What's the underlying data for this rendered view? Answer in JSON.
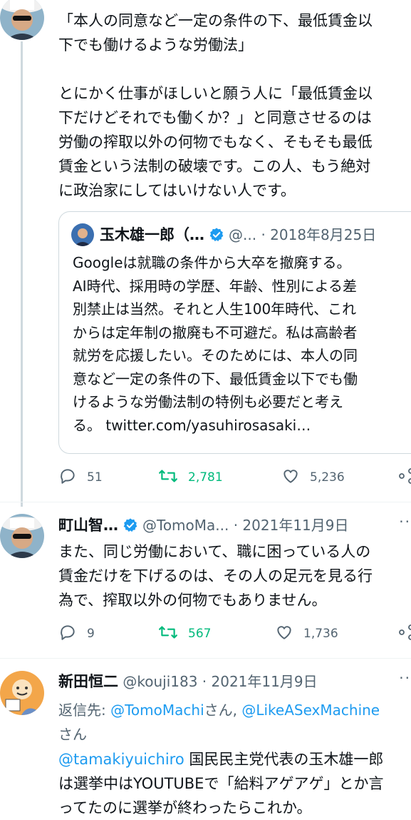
{
  "tweet1": {
    "text": "「本人の同意など一定の条件の下、最低賃金以\n下でも働けるような労働法」\n\nとにかく仕事がほしいと願う人に「最低賃金以\n下だけどそれでも働くか？」と同意させるのは\n労働の搾取以外の何物でもなく、そもそも最低\n賃金という法制の破壊です。この人、もう絶対\nに政治家にしてはいけない人です。",
    "quote": {
      "name": "玉木雄一郎（…",
      "handle": "@...",
      "date": "· 2018年8月25日",
      "text": "Googleは就職の条件から大卒を撤廃する。\nAI時代、採用時の学歴、年齢、性別による差\n別禁止は当然。それと人生100年時代、これ\nからは定年制の撤廃も不可避だ。私は高齢者\n就労を応援したい。そのためには、本人の同\n意など一定の条件の下、最低賃金以下でも働\nけるような労働法制の特例も必要だと考え\nる。 twitter.com/yasuhirosasaki…"
    },
    "replies": "51",
    "retweets": "2,781",
    "likes": "5,236"
  },
  "tweet2": {
    "name": "町山智…",
    "handle": "@TomoMa...",
    "date": "· 2021年11月9日",
    "more": "··",
    "text": "また、同じ労働において、職に困っている人の\n賃金だけを下げるのは、その人の足元を見る行\n為で、搾取以外の何物でもありません。",
    "replies": "9",
    "retweets": "567",
    "likes": "1,736"
  },
  "tweet3": {
    "name": "新田恒二",
    "handle": "@kouji183",
    "date": "· 2021年11月9日",
    "more": "··",
    "reply_prefix": "返信先: ",
    "reply_user1": "@TomoMachi",
    "reply_san1": "さん, ",
    "reply_user2": "@LikeASexMachine",
    "reply_san2": "さん",
    "mention": "@tamakiyuichiro",
    "text_after_mention": " 国民民主党代表の玉木雄一郎",
    "text_rest": "は選挙中はYOUTUBEで「給料アゲアゲ」とか言\nってたのに選挙が終わったらこれか。"
  },
  "icons": [
    "reply-icon",
    "retweet-icon",
    "like-icon",
    "share-icon",
    "verified-icon"
  ],
  "colors": {
    "link": "#1d9bf0",
    "retweet_active": "#00ba7c",
    "muted": "#536471",
    "verified": "#1d9bf0"
  }
}
